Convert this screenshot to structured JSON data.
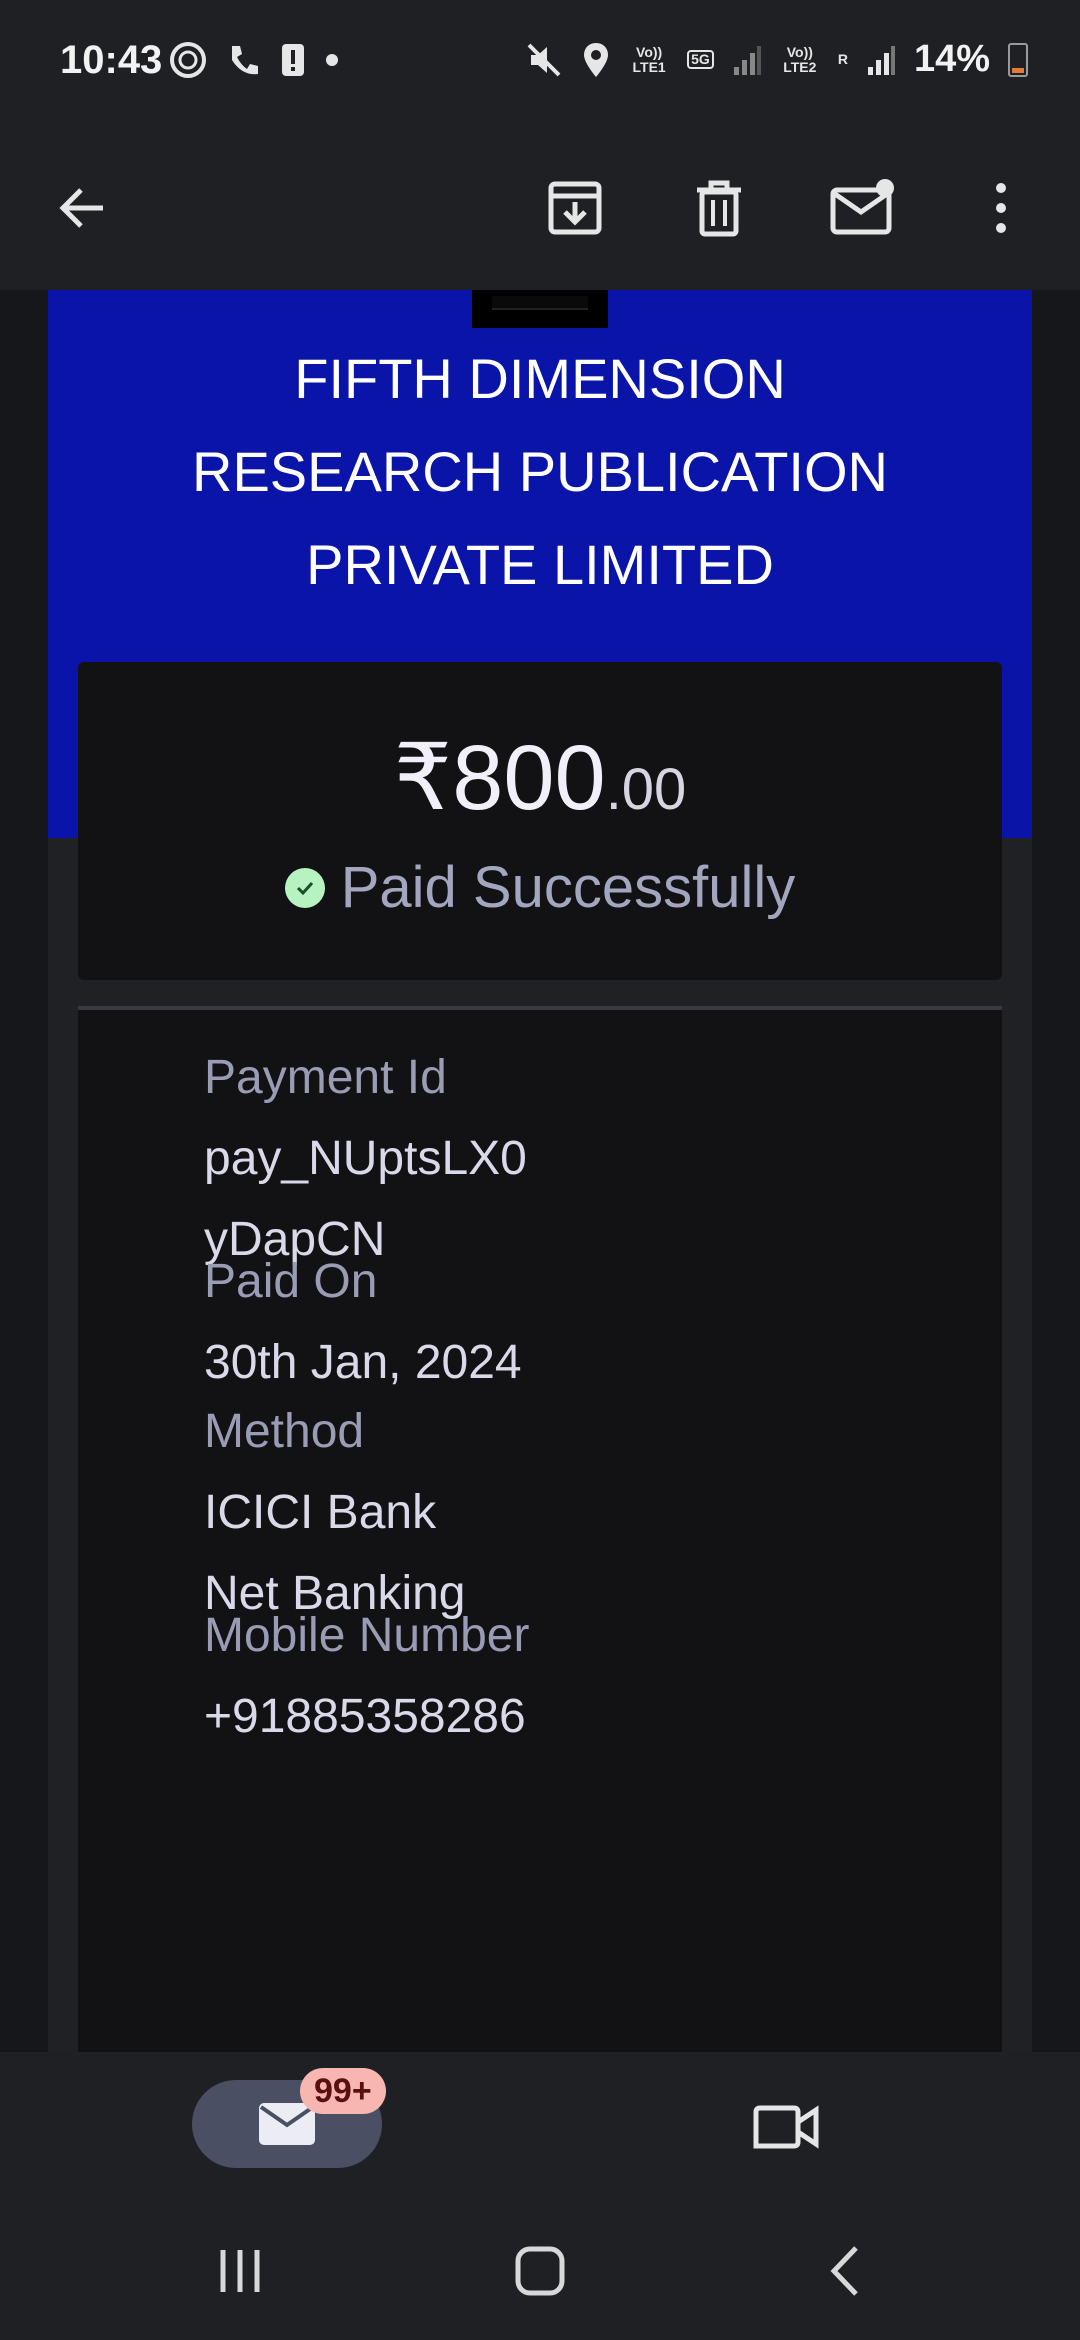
{
  "status_bar": {
    "time": "10:43",
    "network_left": "Vo)) LTE1",
    "network_5g": "5G",
    "network_right": "Vo)) LTE2",
    "roaming": "R",
    "battery": "14%"
  },
  "toolbar": {
    "back_icon": "arrow-left-icon",
    "archive_icon": "archive-icon",
    "delete_icon": "trash-icon",
    "mark_unread_icon": "mail-unread-icon",
    "more_icon": "more-vert-icon"
  },
  "email": {
    "merchant_line1": "FIFTH DIMENSION",
    "merchant_line2": "RESEARCH PUBLICATION",
    "merchant_line3": "PRIVATE LIMITED",
    "amount_main": "₹800",
    "amount_decimals": ".00",
    "status": "Paid Successfully",
    "fields": [
      {
        "label": "Payment Id",
        "value_line1": "pay_NUptsLX0",
        "value_line2": "yDapCN"
      },
      {
        "label": "Paid On",
        "value_line1": "30th Jan, 2024"
      },
      {
        "label": "Method",
        "value_line1": "ICICI Bank",
        "value_line2": "Net Banking"
      },
      {
        "label": "Mobile Number",
        "value_line1": "+91885358286"
      }
    ],
    "colors": {
      "banner": "#0a14a8",
      "success": "#b7f2c1"
    }
  },
  "bottom_nav": {
    "mail_badge": "99+",
    "mail_icon": "mail-icon",
    "meet_icon": "video-camera-icon"
  },
  "system_nav": {
    "recents_icon": "recents-icon",
    "home_icon": "home-icon",
    "back_icon": "back-chevron-icon"
  }
}
